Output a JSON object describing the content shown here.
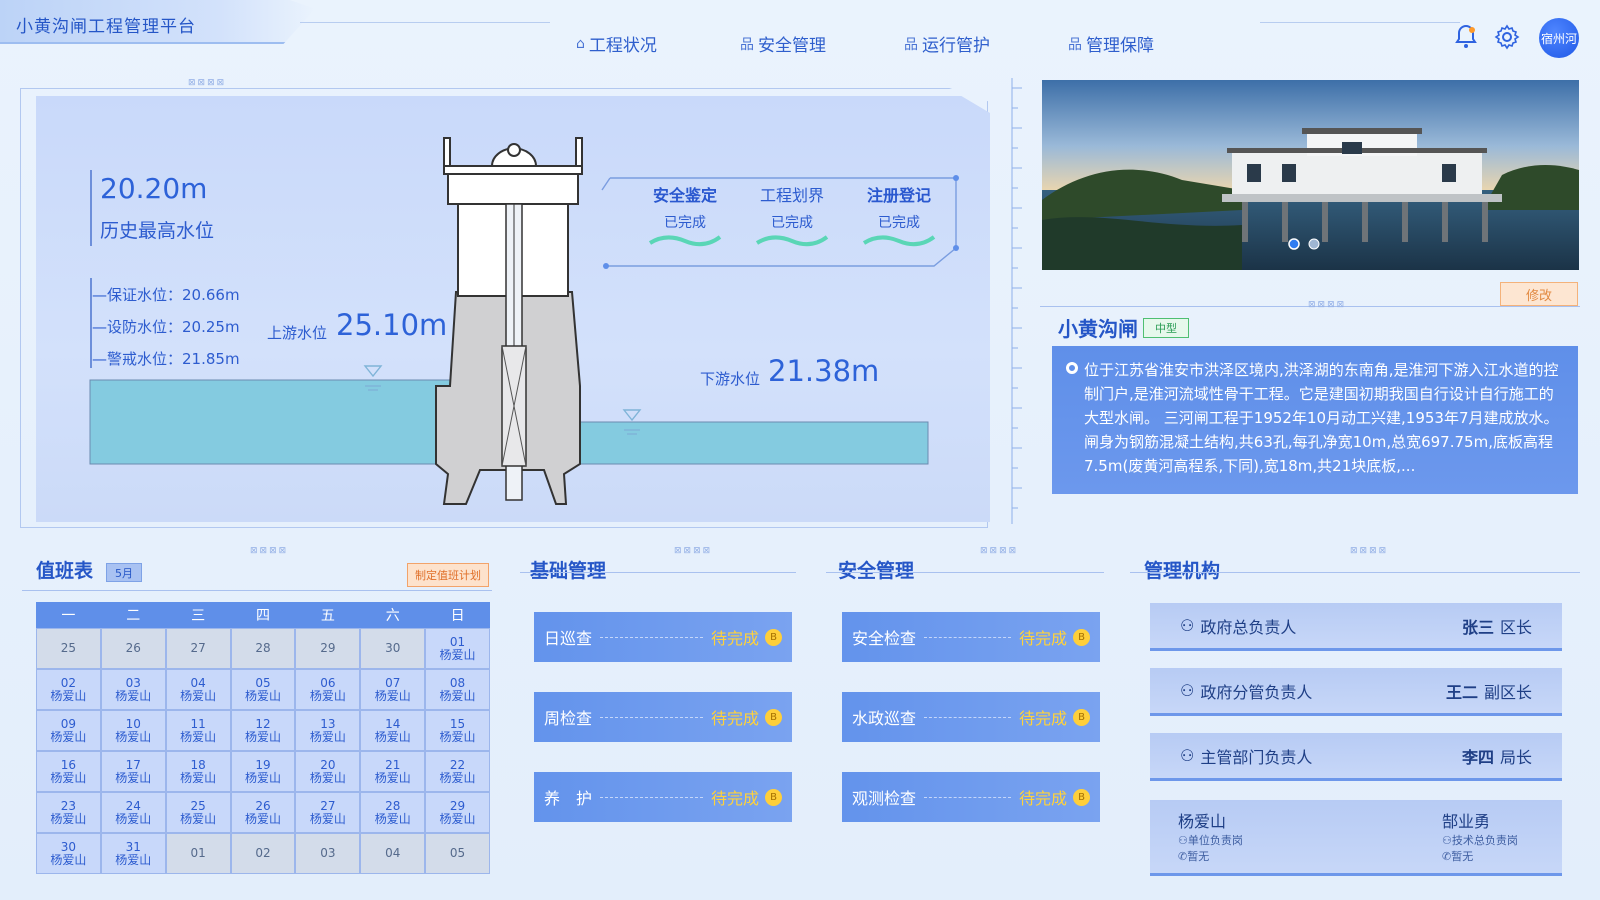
{
  "header": {
    "app_title": "小黄沟闸工程管理平台",
    "nav": [
      {
        "label": "工程状况",
        "icon": "home-icon"
      },
      {
        "label": "安全管理",
        "icon": "org-icon"
      },
      {
        "label": "运行管护",
        "icon": "org-icon"
      },
      {
        "label": "管理保障",
        "icon": "org-icon"
      }
    ],
    "avatar_text": "宿州河"
  },
  "gate": {
    "history_max_value": "20.20m",
    "history_max_label": "历史最高水位",
    "levels": [
      {
        "label": "保证水位：20.66m"
      },
      {
        "label": "设防水位：20.25m"
      },
      {
        "label": "警戒水位：21.85m"
      }
    ],
    "upstream_label": "上游水位",
    "upstream_value": "25.10m",
    "downstream_label": "下游水位",
    "downstream_value": "21.38m",
    "status": [
      {
        "title": "安全鉴定",
        "state": "已完成"
      },
      {
        "title": "工程划界",
        "state": "已完成"
      },
      {
        "title": "注册登记",
        "state": "已完成"
      }
    ]
  },
  "info": {
    "edit_label": "修改",
    "name": "小黄沟闸",
    "tag": "中型",
    "description": "位于江苏省淮安市洪泽区境内,洪泽湖的东南角,是淮河下游入江水道的控制门户,是淮河流域性骨干工程。它是建国初期我国自行设计自行施工的大型水闸。 三河闸工程于1952年10月动工兴建,1953年7月建成放水。闸身为钢筋混凝土结构,共63孔,每孔净宽10m,总宽697.75m,底板高程7.5m(废黄河高程系,下同),宽18m,共21块底板,..."
  },
  "duty": {
    "title": "值班表",
    "month": "5月",
    "plan_button": "制定值班计划",
    "weekdays": [
      "一",
      "二",
      "三",
      "四",
      "五",
      "六",
      "日"
    ],
    "cells": [
      {
        "d": "25",
        "n": "",
        "out": true
      },
      {
        "d": "26",
        "n": "",
        "out": true
      },
      {
        "d": "27",
        "n": "",
        "out": true
      },
      {
        "d": "28",
        "n": "",
        "out": true
      },
      {
        "d": "29",
        "n": "",
        "out": true
      },
      {
        "d": "30",
        "n": "",
        "out": true
      },
      {
        "d": "01",
        "n": "杨爱山",
        "out": false
      },
      {
        "d": "02",
        "n": "杨爱山",
        "out": false
      },
      {
        "d": "03",
        "n": "杨爱山",
        "out": false
      },
      {
        "d": "04",
        "n": "杨爱山",
        "out": false
      },
      {
        "d": "05",
        "n": "杨爱山",
        "out": false
      },
      {
        "d": "06",
        "n": "杨爱山",
        "out": false
      },
      {
        "d": "07",
        "n": "杨爱山",
        "out": false
      },
      {
        "d": "08",
        "n": "杨爱山",
        "out": false
      },
      {
        "d": "09",
        "n": "杨爱山",
        "out": false
      },
      {
        "d": "10",
        "n": "杨爱山",
        "out": false
      },
      {
        "d": "11",
        "n": "杨爱山",
        "out": false
      },
      {
        "d": "12",
        "n": "杨爱山",
        "out": false
      },
      {
        "d": "13",
        "n": "杨爱山",
        "out": false
      },
      {
        "d": "14",
        "n": "杨爱山",
        "out": false
      },
      {
        "d": "15",
        "n": "杨爱山",
        "out": false
      },
      {
        "d": "16",
        "n": "杨爱山",
        "out": false
      },
      {
        "d": "17",
        "n": "杨爱山",
        "out": false
      },
      {
        "d": "18",
        "n": "杨爱山",
        "out": false
      },
      {
        "d": "19",
        "n": "杨爱山",
        "out": false
      },
      {
        "d": "20",
        "n": "杨爱山",
        "out": false
      },
      {
        "d": "21",
        "n": "杨爱山",
        "out": false
      },
      {
        "d": "22",
        "n": "杨爱山",
        "out": false
      },
      {
        "d": "23",
        "n": "杨爱山",
        "out": false
      },
      {
        "d": "24",
        "n": "杨爱山",
        "out": false
      },
      {
        "d": "25",
        "n": "杨爱山",
        "out": false
      },
      {
        "d": "26",
        "n": "杨爱山",
        "out": false
      },
      {
        "d": "27",
        "n": "杨爱山",
        "out": false
      },
      {
        "d": "28",
        "n": "杨爱山",
        "out": false
      },
      {
        "d": "29",
        "n": "杨爱山",
        "out": false
      },
      {
        "d": "30",
        "n": "杨爱山",
        "out": false
      },
      {
        "d": "31",
        "n": "杨爱山",
        "out": false
      },
      {
        "d": "01",
        "n": "",
        "out": true
      },
      {
        "d": "02",
        "n": "",
        "out": true
      },
      {
        "d": "03",
        "n": "",
        "out": true
      },
      {
        "d": "04",
        "n": "",
        "out": true
      },
      {
        "d": "05",
        "n": "",
        "out": true
      }
    ]
  },
  "basic": {
    "title": "基础管理",
    "tasks": [
      {
        "label": "日巡查",
        "state": "待完成"
      },
      {
        "label": "周检查",
        "state": "待完成"
      },
      {
        "label": "养　护",
        "state": "待完成"
      }
    ]
  },
  "safety": {
    "title": "安全管理",
    "tasks": [
      {
        "label": "安全检查",
        "state": "待完成"
      },
      {
        "label": "水政巡查",
        "state": "待完成"
      },
      {
        "label": "观测检查",
        "state": "待完成"
      }
    ]
  },
  "org": {
    "title": "管理机构",
    "rows": [
      {
        "role": "政府总负责人",
        "name": "张三",
        "title": "区长"
      },
      {
        "role": "政府分管负责人",
        "name": "王二",
        "title": "副区长"
      },
      {
        "role": "主管部门负责人",
        "name": "李四",
        "title": "局长"
      }
    ],
    "people": [
      {
        "name": "杨爱山",
        "post": "单位负责岗",
        "phone": "暂无"
      },
      {
        "name": "郜业勇",
        "post": "技术总负责岗",
        "phone": "暂无"
      }
    ]
  },
  "coin_glyph": "B"
}
